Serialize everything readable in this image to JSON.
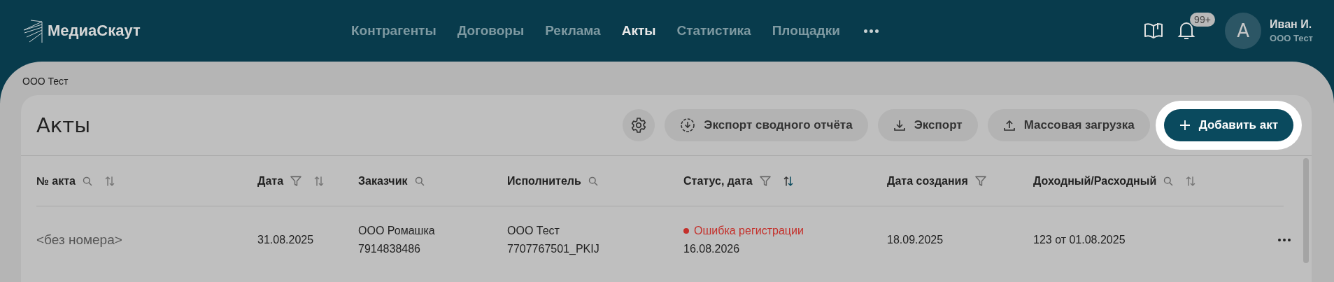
{
  "header": {
    "logo": "МедиаСкаут",
    "nav": [
      {
        "label": "Контрагенты",
        "selected": false
      },
      {
        "label": "Договоры",
        "selected": false
      },
      {
        "label": "Реклама",
        "selected": false
      },
      {
        "label": "Акты",
        "selected": true
      },
      {
        "label": "Статистика",
        "selected": false
      },
      {
        "label": "Площадки",
        "selected": false
      }
    ],
    "notifications_badge": "99+",
    "user": {
      "avatar_letter": "А",
      "name": "Иван И.",
      "company": "ООО Тест"
    }
  },
  "breadcrumb": "ООО Тест",
  "page": {
    "title": "Акты",
    "buttons": [
      {
        "kind": "icon",
        "highlighted": false
      },
      {
        "kind": "secondary",
        "label": "Экспорт сводного отчёта",
        "highlighted": false
      },
      {
        "kind": "secondary",
        "label": "Экспорт",
        "highlighted": false
      },
      {
        "kind": "secondary",
        "label": "Массовая загрузка",
        "highlighted": false
      },
      {
        "kind": "primary",
        "label": "Добавить акт",
        "highlighted": true
      }
    ]
  },
  "table": {
    "columns": [
      {
        "label": "№ акта",
        "search": true,
        "filter": false,
        "sort": true,
        "sort_active": false
      },
      {
        "label": "Дата",
        "search": false,
        "filter": true,
        "sort": true,
        "sort_active": false
      },
      {
        "label": "Заказчик",
        "search": true,
        "filter": false,
        "sort": false
      },
      {
        "label": "Исполнитель",
        "search": true,
        "filter": false,
        "sort": false
      },
      {
        "label": "Статус, дата",
        "search": false,
        "filter": true,
        "sort": true,
        "sort_active": true
      },
      {
        "label": "Дата создания",
        "search": false,
        "filter": true,
        "sort": false
      },
      {
        "label": "Доходный/Расходный",
        "search": true,
        "filter": false,
        "sort": true,
        "sort_active": false
      }
    ],
    "rows": [
      {
        "number": "<без номера>",
        "date": "31.08.2025",
        "customer": [
          "ООО Ромашка",
          "7914838486"
        ],
        "contractor": [
          "ООО Тест",
          "7707767501_PKIJ"
        ],
        "status": {
          "text": "Ошибка регистрации",
          "color": "#c4302b",
          "date": "16.08.2026"
        },
        "created": "18.09.2025",
        "income_expense": "123 от 01.08.2025"
      }
    ]
  }
}
